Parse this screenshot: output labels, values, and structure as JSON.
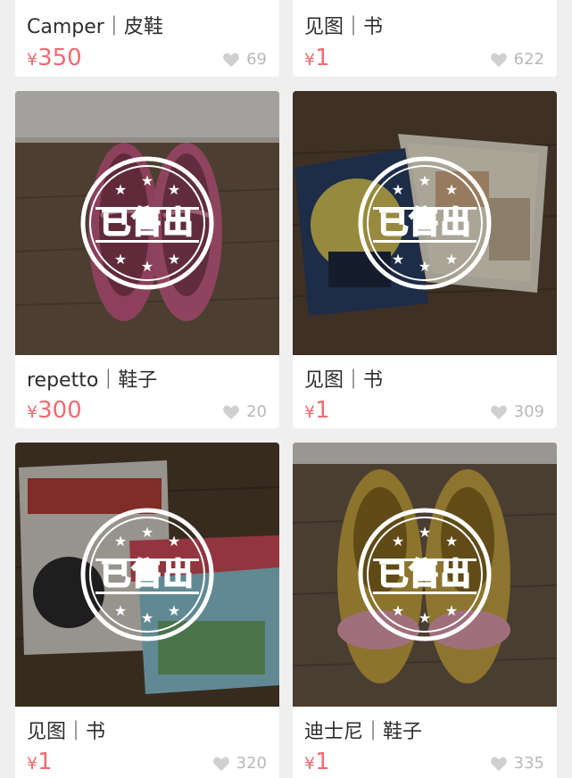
{
  "sold_stamp": "已售出",
  "currency": "¥",
  "items": [
    {
      "title": "Camper｜皮鞋",
      "price": "350",
      "likes": "69",
      "scene": "none",
      "sold": false
    },
    {
      "title": "见图｜书",
      "price": "1",
      "likes": "622",
      "scene": "none",
      "sold": false
    },
    {
      "title": "repetto｜鞋子",
      "price": "300",
      "likes": "20",
      "scene": "pink-shoes",
      "sold": true
    },
    {
      "title": "见图｜书",
      "price": "1",
      "likes": "309",
      "scene": "books-magic",
      "sold": true
    },
    {
      "title": "见图｜书",
      "price": "1",
      "likes": "320",
      "scene": "books-look",
      "sold": true
    },
    {
      "title": "迪士尼｜鞋子",
      "price": "1",
      "likes": "335",
      "scene": "gold-shoes",
      "sold": true
    }
  ],
  "colors": {
    "price": "#f06b72",
    "text": "#2e2e2e",
    "muted": "#b9b9b9",
    "background": "#efefef"
  },
  "icons": {
    "likes": "heart-icon"
  }
}
